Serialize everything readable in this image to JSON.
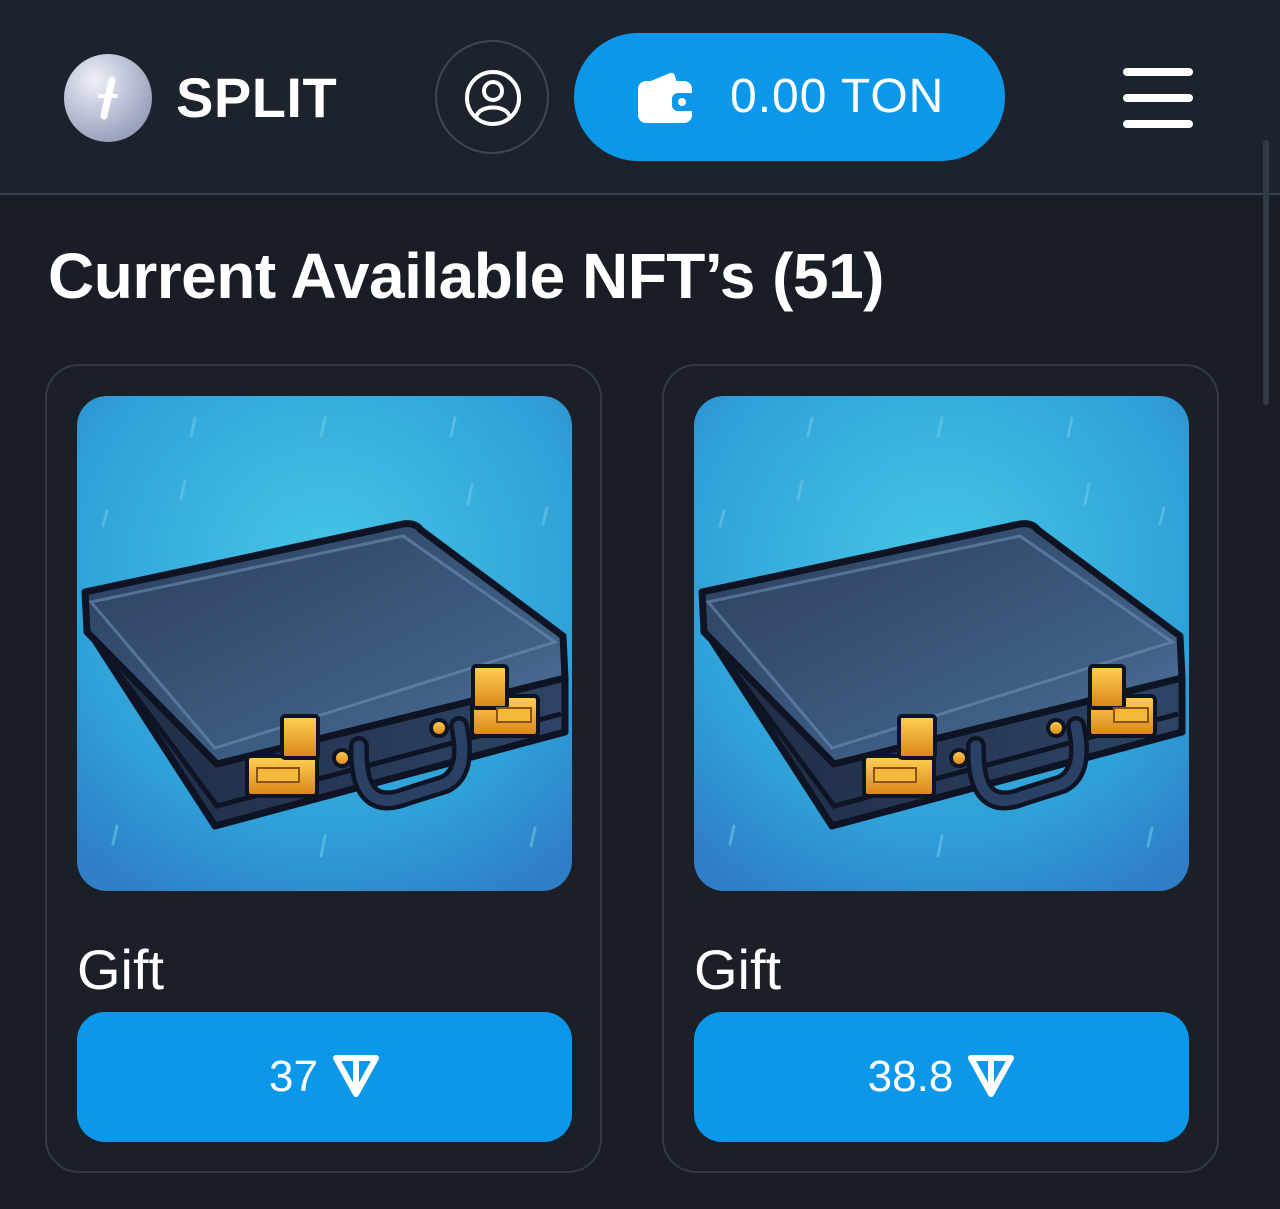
{
  "header": {
    "brand": "SPLIT",
    "balance": "0.00 TON",
    "icons": {
      "logo": "split-logo-icon",
      "profile": "user-icon",
      "wallet": "wallet-icon",
      "menu": "hamburger-menu-icon"
    }
  },
  "main": {
    "title": "Current Available NFT’s (51)",
    "cards": [
      {
        "name": "Gift",
        "price": "37",
        "currency_icon": "ton-icon",
        "image": "briefcase"
      },
      {
        "name": "Gift",
        "price": "38.8",
        "currency_icon": "ton-icon",
        "image": "briefcase"
      }
    ]
  },
  "colors": {
    "accent": "#0b98ea",
    "background": "#181d26",
    "header_bg": "#1d232d",
    "card_border": "#323a46"
  }
}
